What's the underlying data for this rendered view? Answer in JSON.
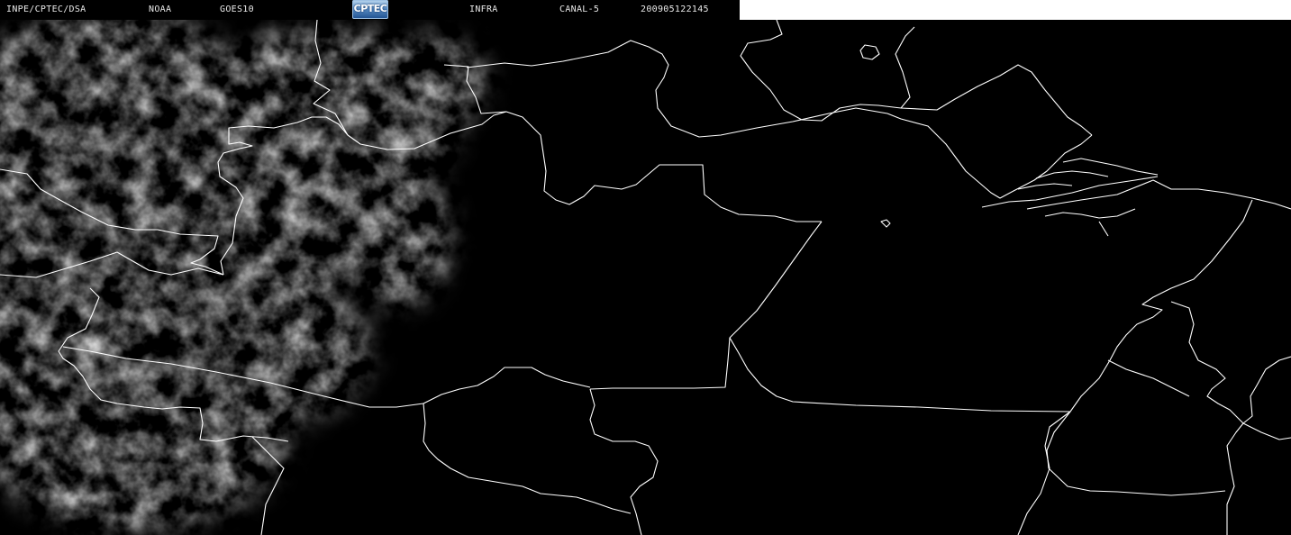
{
  "header": {
    "institution": "INPE/CPTEC/DSA",
    "agency": "NOAA",
    "satellite": "GOES10",
    "logo_text": "CPTEC",
    "product": "INFRA",
    "channel": "CANAL-5",
    "datetime": "200905122145"
  },
  "map": {
    "background_color": "#000000",
    "border_color": "#ffffff",
    "cloud_color": "#bdbdbd"
  }
}
